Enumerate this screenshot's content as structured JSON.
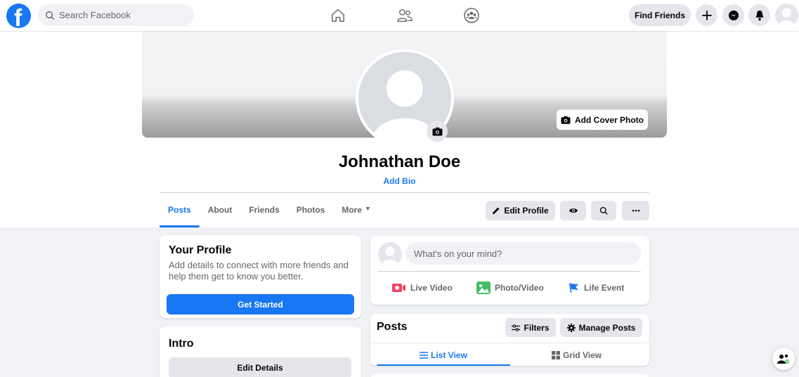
{
  "top_bar": {
    "logo_letter": "f",
    "search_placeholder": "Search Facebook",
    "find_friends_label": "Find Friends",
    "nav_icons": [
      "home-icon",
      "friends-icon",
      "groups-icon"
    ],
    "right_icons": [
      "plus-icon",
      "messenger-icon",
      "notifications-icon",
      "account-avatar"
    ]
  },
  "cover": {
    "add_cover_label": "Add Cover Photo"
  },
  "profile": {
    "name": "Johnathan Doe",
    "add_bio_label": "Add Bio"
  },
  "tabs": [
    {
      "label": "Posts",
      "active": true
    },
    {
      "label": "About",
      "active": false
    },
    {
      "label": "Friends",
      "active": false
    },
    {
      "label": "Photos",
      "active": false
    },
    {
      "label": "More",
      "active": false
    }
  ],
  "header_actions": {
    "edit_profile_label": "Edit Profile",
    "view_as_icon": "eye-icon",
    "search_icon": "search-icon",
    "more_icon": "ellipsis-icon"
  },
  "your_profile": {
    "title": "Your Profile",
    "text": "Add details to connect with more friends and help them get to know you better.",
    "button_label": "Get Started"
  },
  "intro": {
    "title": "Intro",
    "button_label": "Edit Details"
  },
  "composer": {
    "placeholder": "What's on your mind?",
    "actions": [
      {
        "label": "Live Video",
        "icon": "live-video-icon",
        "color": "#f3425f"
      },
      {
        "label": "Photo/Video",
        "icon": "photo-video-icon",
        "color": "#45bd62"
      },
      {
        "label": "Life Event",
        "icon": "life-event-flag-icon",
        "color": "#1877f2"
      }
    ]
  },
  "posts_panel": {
    "title": "Posts",
    "filters_label": "Filters",
    "manage_label": "Manage Posts",
    "list_view_label": "List View",
    "grid_view_label": "Grid View"
  },
  "colors": {
    "accent": "#1877f2",
    "page_bg": "#f0f2f5",
    "button_gray": "#e4e6eb"
  }
}
